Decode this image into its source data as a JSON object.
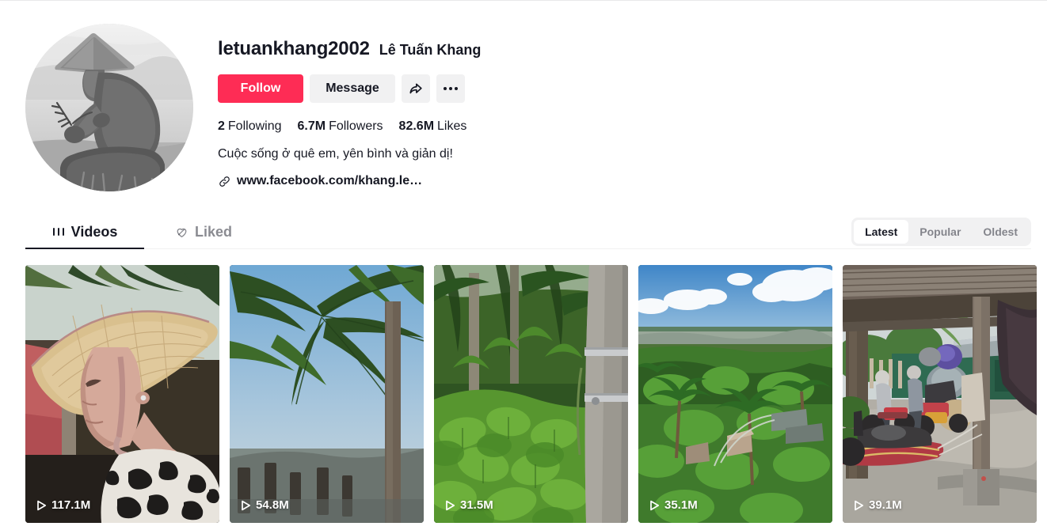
{
  "profile": {
    "username": "letuankhang2002",
    "nickname": "Lê Tuấn Khang",
    "avatar_alt": "avatar",
    "actions": {
      "follow_label": "Follow",
      "message_label": "Message",
      "share_icon": "share-icon",
      "more_icon": "more-options-icon"
    },
    "stats": [
      {
        "num": "2",
        "label": "Following"
      },
      {
        "num": "6.7M",
        "label": "Followers"
      },
      {
        "num": "82.6M",
        "label": "Likes"
      }
    ],
    "bio": "Cuộc sống ở quê em, yên bình và giản dị!",
    "link": "www.facebook.com/khang.le…",
    "link_icon": "link-icon"
  },
  "tabs": [
    {
      "label": "Videos",
      "icon": "grid-icon",
      "active": true
    },
    {
      "label": "Liked",
      "icon": "heart-crossed-icon",
      "active": false
    }
  ],
  "sort": {
    "options": [
      {
        "label": "Latest",
        "active": true
      },
      {
        "label": "Popular",
        "active": false
      },
      {
        "label": "Oldest",
        "active": false
      }
    ]
  },
  "videos": [
    {
      "views": "117.1M",
      "play_icon": "play-icon",
      "alt": "woman-in-conical-hat"
    },
    {
      "views": "54.8M",
      "play_icon": "play-icon",
      "alt": "palm-fronds-against-sky"
    },
    {
      "views": "31.5M",
      "play_icon": "play-icon",
      "alt": "green-garden-with-concrete-pole"
    },
    {
      "views": "35.1M",
      "play_icon": "play-icon",
      "alt": "aerial-view-of-coconut-grove"
    },
    {
      "views": "39.1M",
      "play_icon": "play-icon",
      "alt": "motorbikes-under-tin-roof"
    }
  ],
  "colors": {
    "accent": "#fe2c55",
    "text": "#161823",
    "muted": "rgba(22,24,35,0.5)",
    "surface": "#f1f1f2"
  }
}
